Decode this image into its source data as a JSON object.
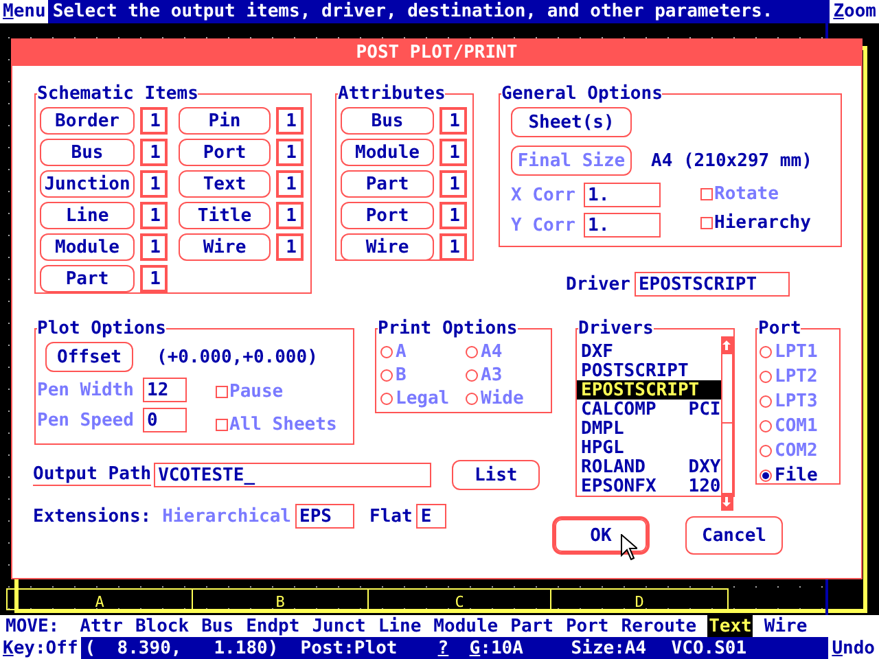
{
  "menu_bar": {
    "menu": "Menu",
    "prompt": "Select the output items, driver, destination, and other parameters.",
    "zoom": "Zoom"
  },
  "dialog": {
    "title": "POST PLOT/PRINT",
    "schematic_items": {
      "title": "Schematic Items",
      "columns": [
        [
          {
            "label": "Border",
            "value": "1"
          },
          {
            "label": "Bus",
            "value": "1"
          },
          {
            "label": "Junction",
            "value": "1"
          },
          {
            "label": "Line",
            "value": "1"
          },
          {
            "label": "Module",
            "value": "1"
          },
          {
            "label": "Part",
            "value": "1"
          }
        ],
        [
          {
            "label": "Pin",
            "value": "1"
          },
          {
            "label": "Port",
            "value": "1"
          },
          {
            "label": "Text",
            "value": "1"
          },
          {
            "label": "Title",
            "value": "1"
          },
          {
            "label": "Wire",
            "value": "1"
          }
        ]
      ]
    },
    "attributes": {
      "title": "Attributes",
      "items": [
        {
          "label": "Bus",
          "value": "1"
        },
        {
          "label": "Module",
          "value": "1"
        },
        {
          "label": "Part",
          "value": "1"
        },
        {
          "label": "Port",
          "value": "1"
        },
        {
          "label": "Wire",
          "value": "1"
        }
      ]
    },
    "general_options": {
      "title": "General Options",
      "sheets_button": "Sheet(s)",
      "final_size": {
        "label": "Final Size",
        "disabled": true
      },
      "size_text": "A4 (210x297 mm)",
      "fields": [
        {
          "label": "X Corr",
          "value": "1.",
          "disabled": true
        },
        {
          "label": "Y Corr",
          "value": "1.",
          "disabled": true
        }
      ],
      "checkboxes": [
        {
          "label": "Rotate",
          "checked": false,
          "disabled": true
        },
        {
          "label": "Hierarchy",
          "checked": false,
          "disabled": false
        }
      ]
    },
    "driver": {
      "label": "Driver",
      "value": "EPOSTSCRIPT"
    },
    "plot_options": {
      "title": "Plot Options",
      "offset_button": "Offset",
      "offset_value": "(+0.000,+0.000)",
      "fields": [
        {
          "label": "Pen Width",
          "value": "12",
          "disabled": true
        },
        {
          "label": "Pen Speed",
          "value": "0",
          "disabled": true
        }
      ],
      "checkboxes": [
        {
          "label": "Pause",
          "checked": false,
          "disabled": true
        },
        {
          "label": "All Sheets",
          "checked": false,
          "disabled": true
        }
      ]
    },
    "print_options": {
      "title": "Print Options",
      "options": [
        {
          "label": "A",
          "selected": false,
          "disabled": true
        },
        {
          "label": "A4",
          "selected": false,
          "disabled": true
        },
        {
          "label": "B",
          "selected": false,
          "disabled": true
        },
        {
          "label": "A3",
          "selected": false,
          "disabled": true
        },
        {
          "label": "Legal",
          "selected": false,
          "disabled": true
        },
        {
          "label": "Wide",
          "selected": false,
          "disabled": true
        }
      ]
    },
    "drivers": {
      "title": "Drivers",
      "items": [
        {
          "label": "DXF",
          "selected": false
        },
        {
          "label": "POSTSCRIPT",
          "selected": false
        },
        {
          "label": "EPOSTSCRIPT",
          "selected": true
        },
        {
          "label": "CALCOMP   PCI",
          "selected": false
        },
        {
          "label": "DMPL",
          "selected": false
        },
        {
          "label": "HPGL",
          "selected": false
        },
        {
          "label": "ROLAND    DXY",
          "selected": false
        },
        {
          "label": "EPSONFX   120",
          "selected": false
        }
      ]
    },
    "port": {
      "title": "Port",
      "options": [
        {
          "label": "LPT1",
          "selected": false,
          "disabled": true
        },
        {
          "label": "LPT2",
          "selected": false,
          "disabled": true
        },
        {
          "label": "LPT3",
          "selected": false,
          "disabled": true
        },
        {
          "label": "COM1",
          "selected": false,
          "disabled": true
        },
        {
          "label": "COM2",
          "selected": false,
          "disabled": true
        },
        {
          "label": "File",
          "selected": true,
          "disabled": false
        }
      ]
    },
    "output_path": {
      "label": "Output Path",
      "value": "VCOTESTE_"
    },
    "list_button": "List",
    "extensions": {
      "label": "Extensions:",
      "fields": [
        {
          "label": "Hierarchical",
          "value": "EPS",
          "disabled": true
        },
        {
          "label": "Flat",
          "value": "E",
          "disabled": false
        }
      ]
    },
    "buttons": [
      {
        "label": "OK",
        "default": true
      },
      {
        "label": "Cancel",
        "default": false
      }
    ]
  },
  "sheet_border": {
    "zones": [
      "A",
      "B",
      "C",
      "D"
    ]
  },
  "command_bar": {
    "label": "MOVE:",
    "commands": [
      {
        "label": "Attr",
        "selected": false
      },
      {
        "label": "Block",
        "selected": false
      },
      {
        "label": "Bus",
        "selected": false
      },
      {
        "label": "Endpt",
        "selected": false
      },
      {
        "label": "Junct",
        "selected": false
      },
      {
        "label": "Line",
        "selected": false
      },
      {
        "label": "Module",
        "selected": false
      },
      {
        "label": "Part",
        "selected": false
      },
      {
        "label": "Port",
        "selected": false
      },
      {
        "label": "Reroute",
        "selected": false
      },
      {
        "label": "Text",
        "selected": true
      },
      {
        "label": "Wire",
        "selected": false
      }
    ]
  },
  "status_bar": {
    "key": "Key:Off",
    "coords": "(  8.390,   1.180)",
    "post": "Post:Plot",
    "help": "?",
    "grid": "G:10A",
    "size": "Size:A4",
    "file": "VCO.S01",
    "undo": "Undo"
  }
}
